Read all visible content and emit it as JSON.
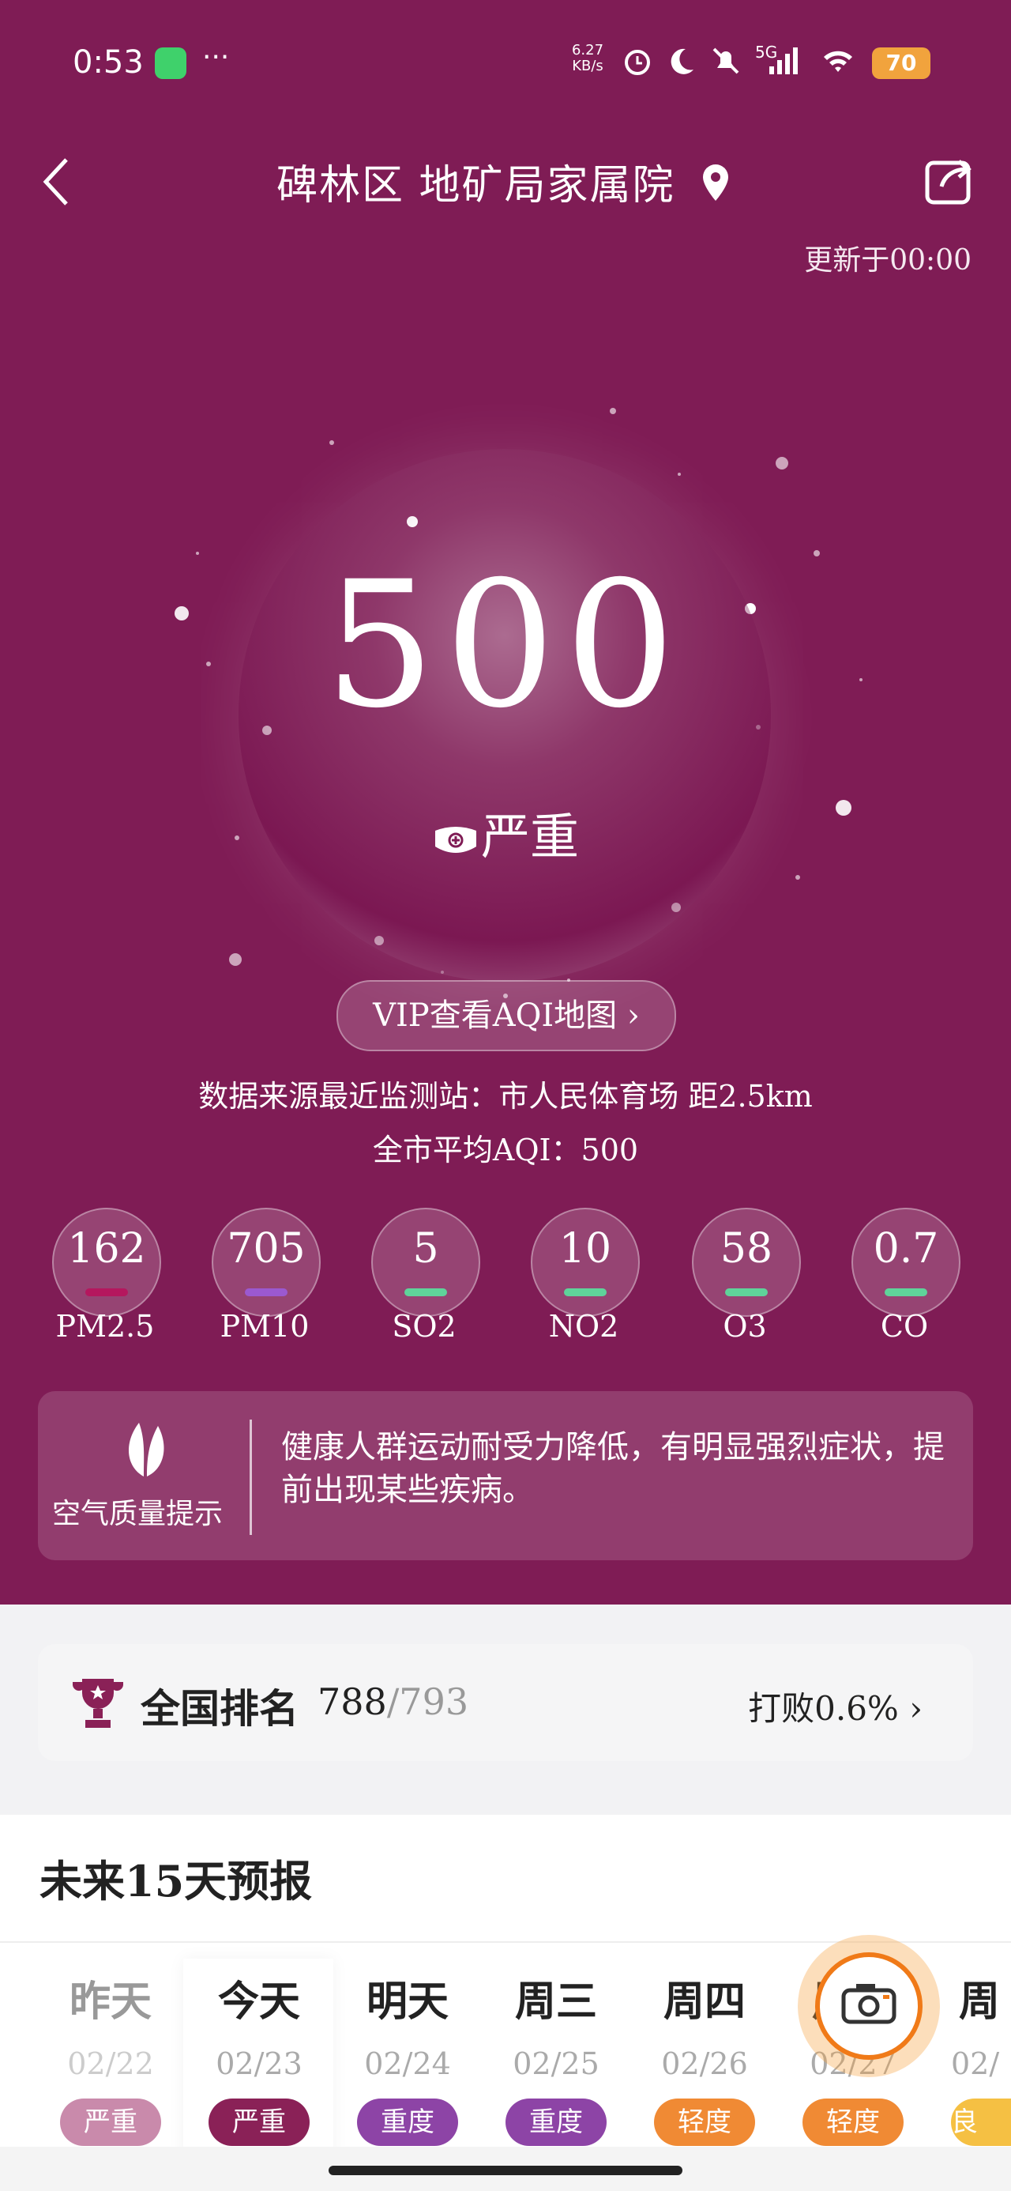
{
  "status": {
    "time": "0:53",
    "speed_value": "6.27",
    "speed_unit": "KB/s",
    "network": "5G",
    "battery": "70"
  },
  "header": {
    "title": "碑林区  地矿局家属院",
    "updated": "更新于00:00"
  },
  "aqi": {
    "value": "500",
    "level": "严重",
    "vip_button": "VIP查看AQI地图 ›",
    "source": "数据来源最近监测站：市人民体育场 距2.5km",
    "city_avg": "全市平均AQI：500"
  },
  "pollutants": [
    {
      "value": "162",
      "name": "PM2.5",
      "color": "#b5175e"
    },
    {
      "value": "705",
      "name": "PM10",
      "color": "#9b59d0"
    },
    {
      "value": "5",
      "name": "SO2",
      "color": "#5fd39a"
    },
    {
      "value": "10",
      "name": "NO2",
      "color": "#5fd39a"
    },
    {
      "value": "58",
      "name": "O3",
      "color": "#5fd39a"
    },
    {
      "value": "0.7",
      "name": "CO",
      "color": "#5fd39a"
    }
  ],
  "tip": {
    "label": "空气质量提示",
    "text": "健康人群运动耐受力降低，有明显强烈症状，提前出现某些疾病。"
  },
  "rank": {
    "label": "全国排名",
    "num": "788",
    "den": "/793",
    "beat": "打败0.6%"
  },
  "forecast": {
    "title": "未来15天预报",
    "days": [
      {
        "name": "昨天",
        "date": "02/22",
        "level": "严重",
        "color": "#c98aab",
        "dim": true
      },
      {
        "name": "今天",
        "date": "02/23",
        "level": "严重",
        "color": "#8a2157",
        "dim": false
      },
      {
        "name": "明天",
        "date": "02/24",
        "level": "重度",
        "color": "#8d44a6",
        "dim": false
      },
      {
        "name": "周三",
        "date": "02/25",
        "level": "重度",
        "color": "#8d44a6",
        "dim": false
      },
      {
        "name": "周四",
        "date": "02/26",
        "level": "轻度",
        "color": "#f08a34",
        "dim": false
      },
      {
        "name": "周五",
        "date": "02/27",
        "level": "轻度",
        "color": "#f08a34",
        "dim": false
      },
      {
        "name": "周",
        "date": "02/",
        "level": "良",
        "color": "#f5c043",
        "dim": false
      }
    ]
  }
}
